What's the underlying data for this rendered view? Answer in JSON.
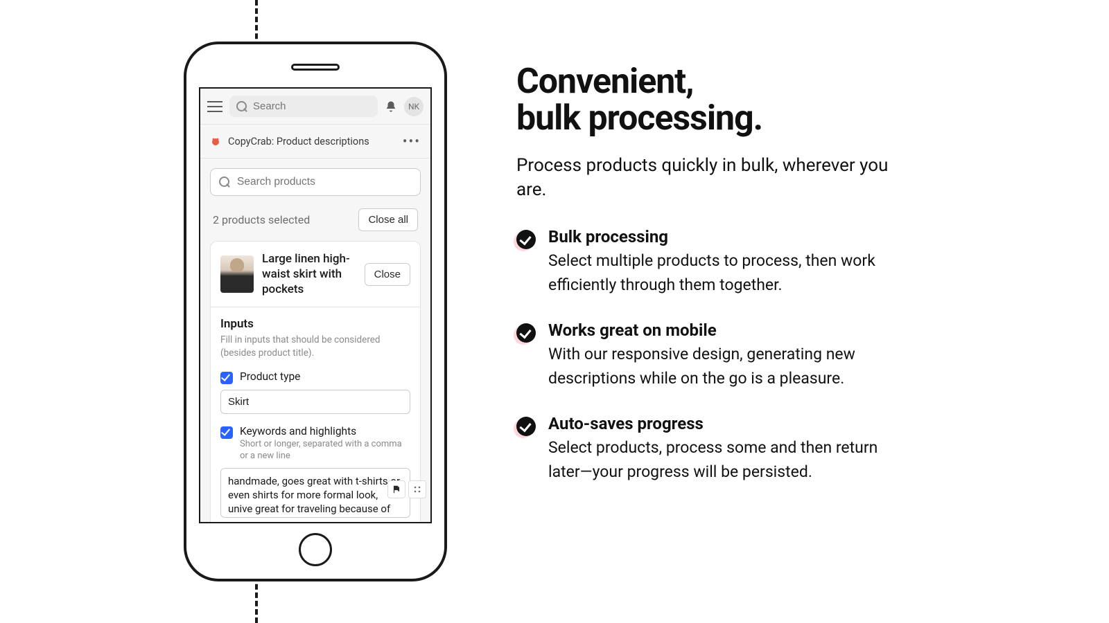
{
  "topbar": {
    "search_placeholder": "Search",
    "avatar_initials": "NK"
  },
  "appbar": {
    "title": "CopyCrab: Product descriptions"
  },
  "search_products_placeholder": "Search products",
  "selection": {
    "text": "2 products selected",
    "close_all": "Close all"
  },
  "product": {
    "title": "Large linen high-waist skirt with pockets",
    "close": "Close"
  },
  "inputs": {
    "heading": "Inputs",
    "help": "Fill in inputs that should be considered (besides product title).",
    "product_type_label": "Product type",
    "product_type_value": "Skirt",
    "keywords_label": "Keywords and highlights",
    "keywords_help": "Short or longer, separated with a comma or a new line",
    "keywords_value": "handmade, goes great with t-shirts or even shirts for more formal look, unive great for traveling because of how"
  },
  "marketing": {
    "headline_l1": "Convenient,",
    "headline_l2": "bulk processing.",
    "subhead": "Process products quickly in bulk, wherever you are.",
    "features": [
      {
        "title": "Bulk processing",
        "desc": "Select multiple products to process, then work efficiently through them together."
      },
      {
        "title": "Works great on mobile",
        "desc": "With our responsive design, generating new descriptions while on the go is a pleasure."
      },
      {
        "title": "Auto-saves progress",
        "desc": "Select products, process some and then return later—your progress will be persisted."
      }
    ]
  }
}
